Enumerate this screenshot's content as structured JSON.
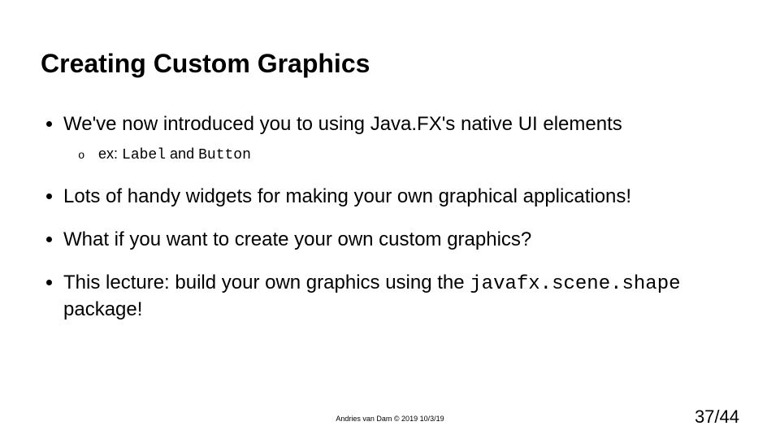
{
  "title": "Creating Custom Graphics",
  "bullets": {
    "b1": "We've now introduced you to using Java.FX's native UI elements",
    "b1sub_prefix": "ex: ",
    "b1sub_code1": "Label",
    "b1sub_mid": " and ",
    "b1sub_code2": "Button",
    "b2": "Lots of handy widgets for making your own graphical applications!",
    "b3": "What if you want to create your own custom graphics?",
    "b4_prefix": "This lecture: build your own graphics using the ",
    "b4_code": "javafx.scene.shape",
    "b4_suffix": " package!"
  },
  "footer": {
    "credit": "Andries van Dam © 2019 10/3/19",
    "page": "37/44"
  }
}
